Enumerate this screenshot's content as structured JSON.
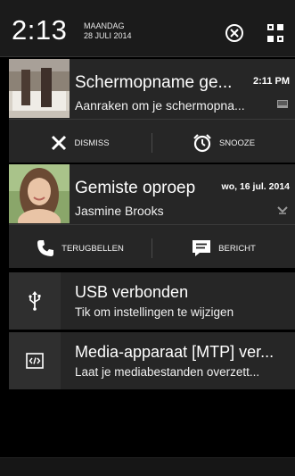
{
  "header": {
    "time": "2:13",
    "day": "MAANDAG",
    "date": "28 JULI 2014",
    "clear_icon": "circle-x-icon",
    "settings_icon": "quick-settings-icon"
  },
  "notifications": [
    {
      "title": "Schermopname ge...",
      "subtitle": "Aanraken om je schermopna...",
      "time": "2:11 PM",
      "thumb": "screenshot-thumbnail",
      "actions": [
        {
          "label": "DISMISS",
          "icon": "close-icon"
        },
        {
          "label": "SNOOZE",
          "icon": "alarm-clock-icon"
        }
      ]
    },
    {
      "title": "Gemiste oproep",
      "subtitle": "Jasmine Brooks",
      "time": "wo, 16 jul. 2014",
      "thumb": "contact-photo",
      "actions": [
        {
          "label": "TERUGBELLEN",
          "icon": "phone-icon"
        },
        {
          "label": "BERICHT",
          "icon": "message-icon"
        }
      ]
    }
  ],
  "system": [
    {
      "title": "USB verbonden",
      "subtitle": "Tik om instellingen te wijzigen",
      "icon": "usb-icon"
    },
    {
      "title": "Media-apparaat [MTP] ver...",
      "subtitle": "Laat je mediabestanden overzett...",
      "icon": "code-icon"
    }
  ],
  "colors": {
    "background": "#000000",
    "card": "#262626",
    "header": "#1b1b1b"
  }
}
